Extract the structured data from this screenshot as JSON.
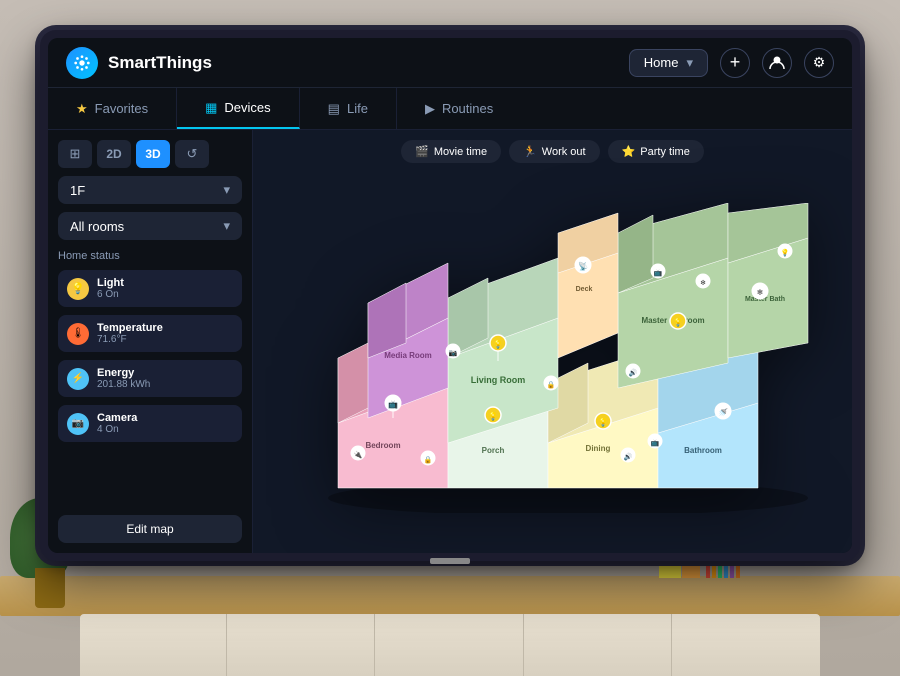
{
  "app": {
    "name": "SmartThings"
  },
  "header": {
    "logo_icon": "⚙",
    "home_label": "Home",
    "add_icon": "+",
    "profile_icon": "👤",
    "settings_icon": "⚙"
  },
  "nav": {
    "tabs": [
      {
        "id": "favorites",
        "label": "Favorites",
        "icon": "★",
        "active": false
      },
      {
        "id": "devices",
        "label": "Devices",
        "icon": "▦",
        "active": true
      },
      {
        "id": "life",
        "label": "Life",
        "icon": "≡",
        "active": false
      },
      {
        "id": "routines",
        "label": "Routines",
        "icon": "▶",
        "active": false
      }
    ]
  },
  "sidebar": {
    "view_controls": [
      {
        "id": "grid",
        "label": "⊞",
        "active": false
      },
      {
        "id": "2d",
        "label": "2D",
        "active": false
      },
      {
        "id": "3d",
        "label": "3D",
        "active": true
      },
      {
        "id": "history",
        "label": "↺",
        "active": false
      }
    ],
    "floor_selector": {
      "value": "1F",
      "icon": "▾"
    },
    "room_selector": {
      "value": "All rooms",
      "icon": "▾"
    },
    "home_status_title": "Home status",
    "status_items": [
      {
        "id": "light",
        "name": "Light",
        "value": "6 On",
        "icon": "💡",
        "color": "#f5c842"
      },
      {
        "id": "temperature",
        "name": "Temperature",
        "value": "71.6°F",
        "icon": "🌡",
        "color": "#ff6b35"
      },
      {
        "id": "energy",
        "name": "Energy",
        "value": "201.88 kWh",
        "icon": "⚡",
        "color": "#4fc3f7"
      },
      {
        "id": "camera",
        "name": "Camera",
        "value": "4 On",
        "icon": "📷",
        "color": "#4fc3f7"
      }
    ],
    "edit_map_btn": "Edit map"
  },
  "scenes": [
    {
      "id": "movie",
      "label": "Movie time",
      "icon": "🎬"
    },
    {
      "id": "workout",
      "label": "Work out",
      "icon": "🏃"
    },
    {
      "id": "party",
      "label": "Party time",
      "icon": "⭐"
    }
  ],
  "rooms": [
    {
      "id": "master-bedroom",
      "label": "Master Bedroom",
      "color": "#b5d5a8"
    },
    {
      "id": "living-room",
      "label": "Living Room",
      "color": "#c8e6c9"
    },
    {
      "id": "bedroom",
      "label": "Bedroom",
      "color": "#f8bbd0"
    },
    {
      "id": "dining-room",
      "label": "Dining",
      "color": "#fff9c4"
    },
    {
      "id": "bathroom",
      "label": "Bathroom",
      "color": "#b3e5fc"
    },
    {
      "id": "deck",
      "label": "Deck",
      "color": "#ffe0b2"
    },
    {
      "id": "media-room",
      "label": "Media Room",
      "color": "#ce93d8"
    },
    {
      "id": "porch",
      "label": "Porch",
      "color": "#e8f5e9"
    },
    {
      "id": "master-bath",
      "label": "Master Bath",
      "color": "#b3e5fc"
    }
  ]
}
